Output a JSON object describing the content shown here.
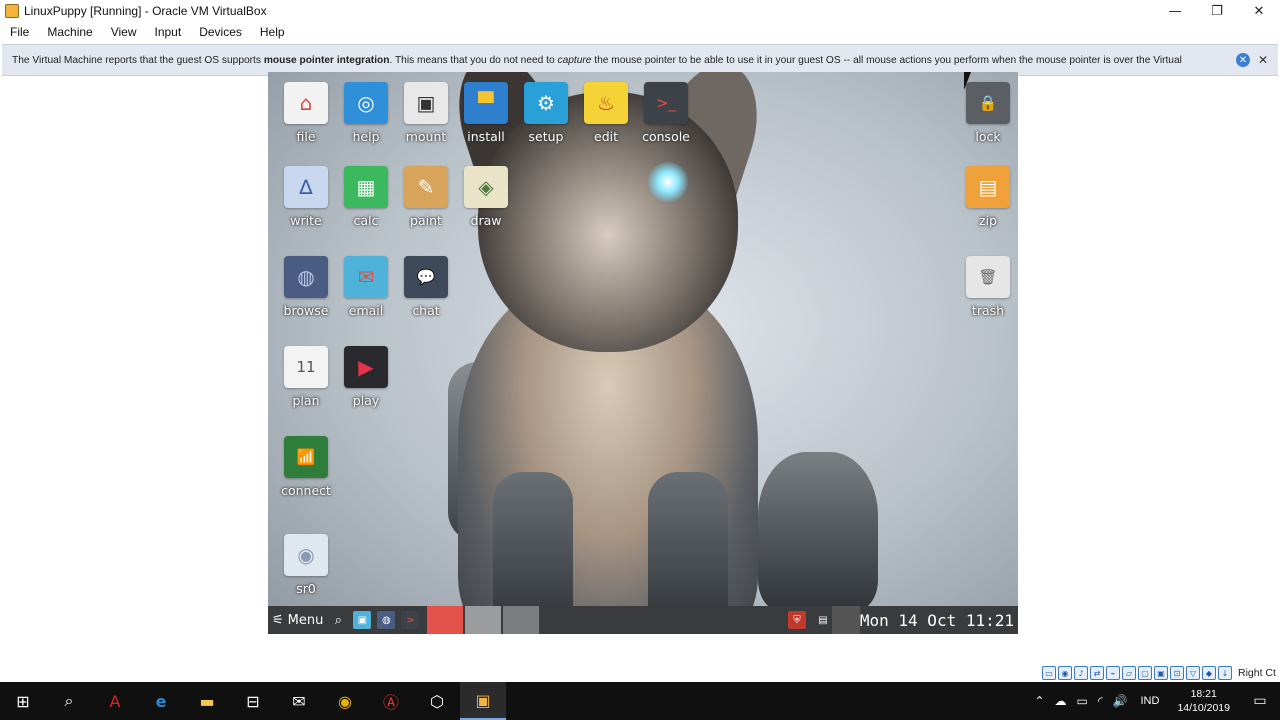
{
  "window": {
    "title": "LinuxPuppy [Running] - Oracle VM VirtualBox",
    "minimize": "—",
    "restore": "❐",
    "close": "✕"
  },
  "menubar": [
    "File",
    "Machine",
    "View",
    "Input",
    "Devices",
    "Help"
  ],
  "notification": {
    "part1": "The Virtual Machine reports that the guest OS supports ",
    "bold": "mouse pointer integration",
    "part2": ". This means that you do not need to ",
    "italic": "capture",
    "part3": " the mouse pointer to be able to use it in your guest OS -- all mouse actions you perform when the mouse pointer is over the Virtual"
  },
  "desktop_icons": [
    {
      "label": "file",
      "icon": "home-folder-icon",
      "glyph": "⌂",
      "color": "#f2f2f2",
      "fg": "#d94a38"
    },
    {
      "label": "help",
      "icon": "lifebuoy-icon",
      "glyph": "◎",
      "color": "#2f8fd8",
      "fg": "#ffffff"
    },
    {
      "label": "mount",
      "icon": "disk-drive-icon",
      "glyph": "▣",
      "color": "#e8e8e8",
      "fg": "#333333"
    },
    {
      "label": "install",
      "icon": "package-icon",
      "glyph": "▀",
      "color": "#2f7fcf",
      "fg": "#f4c430"
    },
    {
      "label": "setup",
      "icon": "gear-icon",
      "glyph": "⚙",
      "color": "#2aa0d8",
      "fg": "#ffffff"
    },
    {
      "label": "edit",
      "icon": "genie-lamp-icon",
      "glyph": "♨",
      "color": "#f5d236",
      "fg": "#c0392b"
    },
    {
      "label": "console",
      "icon": "terminal-icon",
      "glyph": ">_",
      "color": "#3c4248",
      "fg": "#e74c3c"
    },
    {
      "label": "write",
      "icon": "word-processor-icon",
      "glyph": "∆",
      "color": "#c9d8ef",
      "fg": "#3b5ea8"
    },
    {
      "label": "calc",
      "icon": "spreadsheet-icon",
      "glyph": "▦",
      "color": "#3cb95f",
      "fg": "#ffffff"
    },
    {
      "label": "paint",
      "icon": "paint-palette-icon",
      "glyph": "✎",
      "color": "#d8a35a",
      "fg": "#ffffff"
    },
    {
      "label": "draw",
      "icon": "vector-draw-icon",
      "glyph": "◈",
      "color": "#e9e4c8",
      "fg": "#4f7b3f"
    },
    {
      "label": "browse",
      "icon": "globe-browser-icon",
      "glyph": "◍",
      "color": "#4a5c82",
      "fg": "#b9c9ea"
    },
    {
      "label": "email",
      "icon": "envelope-icon",
      "glyph": "✉",
      "color": "#4fb3d9",
      "fg": "#e74c3c"
    },
    {
      "label": "chat",
      "icon": "chat-bubble-icon",
      "glyph": "💬",
      "color": "#3e4a5a",
      "fg": "#ffffff"
    },
    {
      "label": "plan",
      "icon": "calendar-icon",
      "glyph": "11",
      "color": "#f3f3f3",
      "fg": "#555555"
    },
    {
      "label": "play",
      "icon": "media-player-icon",
      "glyph": "▶",
      "color": "#2a2a2e",
      "fg": "#e6334a"
    },
    {
      "label": "connect",
      "icon": "network-antenna-icon",
      "glyph": "📶",
      "color": "#2f7d3a",
      "fg": "#ffffff"
    },
    {
      "label": "sr0",
      "icon": "optical-disc-icon",
      "glyph": "◉",
      "color": "#dfe7f0",
      "fg": "#8a9bb0"
    },
    {
      "label": "lock",
      "icon": "padlock-icon",
      "glyph": "🔒",
      "color": "#5b5f63",
      "fg": "#f0c020"
    },
    {
      "label": "zip",
      "icon": "archive-icon",
      "glyph": "▤",
      "color": "#f0a13a",
      "fg": "#ffffff"
    },
    {
      "label": "trash",
      "icon": "trash-can-icon",
      "glyph": "🗑",
      "color": "#e6e6e6",
      "fg": "#666666"
    }
  ],
  "vm_taskbar": {
    "menu_label": "Menu",
    "clock": "Mon 14 Oct 11:21"
  },
  "vb_status": {
    "host_key": "Right Ct"
  },
  "win_taskbar": {
    "language": "IND",
    "time": "18:21",
    "date": "14/10/2019"
  }
}
